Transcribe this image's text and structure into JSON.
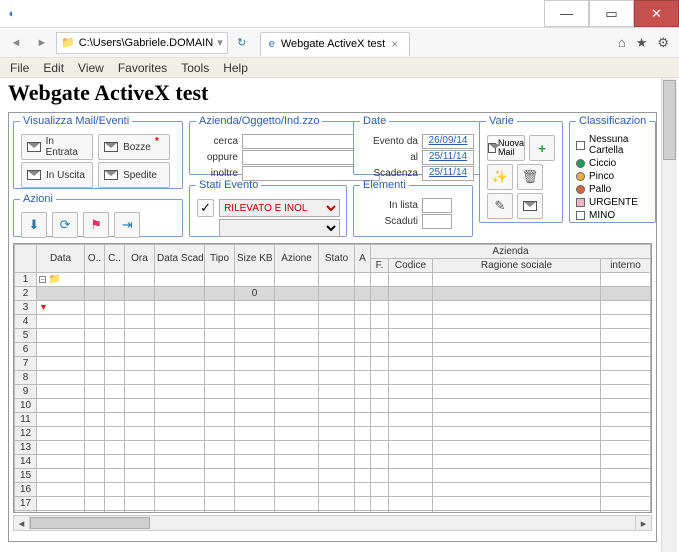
{
  "window": {
    "address": "C:\\Users\\Gabriele.DOMAIN",
    "tab_title": "Webgate ActiveX test",
    "menus": [
      "File",
      "Edit",
      "View",
      "Favorites",
      "Tools",
      "Help"
    ]
  },
  "page_title": "Webgate ActiveX test",
  "mail": {
    "legend": "Visualizza Mail/Eventi",
    "in_entrata": "In Entrata",
    "bozze": "Bozze",
    "in_uscita": "In Uscita",
    "spedite": "Spedite"
  },
  "azioni": {
    "legend": "Azioni"
  },
  "search": {
    "legend": "Azienda/Oggetto/Ind.zzo",
    "l1": "cerca",
    "l2": "oppure",
    "l3": "inoltre",
    "v1": "",
    "v2": "",
    "v3": ""
  },
  "stati": {
    "legend": "Stati Evento",
    "sel1": "RILEVATO E INOL",
    "sel2": ""
  },
  "date": {
    "legend": "Date",
    "l1": "Evento da",
    "v1": "26/09/14",
    "l2": "al",
    "v2": "25/11/14",
    "l3": "Scadenza",
    "v3": "25/11/14"
  },
  "elementi": {
    "legend": "Elementi",
    "l1": "In lista",
    "v1": "",
    "l2": "Scaduti",
    "v2": ""
  },
  "varie": {
    "legend": "Varie",
    "nuova_mail": "Nuova Mail"
  },
  "class": {
    "legend": "Classificazion",
    "items": [
      {
        "label": "Nessuna Cartella",
        "type": "sq",
        "color": "#fff"
      },
      {
        "label": "Ciccio",
        "type": "dot",
        "color": "#1a9c5b"
      },
      {
        "label": "Pinco",
        "type": "dot",
        "color": "#e8b23a"
      },
      {
        "label": "Pallo",
        "type": "dot",
        "color": "#d9663a"
      },
      {
        "label": "URGENTE",
        "type": "sq",
        "color": "#e9b6c9"
      },
      {
        "label": "MINO",
        "type": "sq",
        "color": "#fff"
      }
    ]
  },
  "grid": {
    "headers1": [
      "",
      "Data",
      "O..",
      "C..",
      "Ora",
      "Data Scadenza",
      "Tipo",
      "Size KB",
      "Azione",
      "Stato",
      "A",
      "Azienda"
    ],
    "headers2_az": [
      "F.",
      "Codice",
      "Ragione sociale",
      "interno"
    ],
    "row2_zero": "0",
    "row_count": 18
  }
}
